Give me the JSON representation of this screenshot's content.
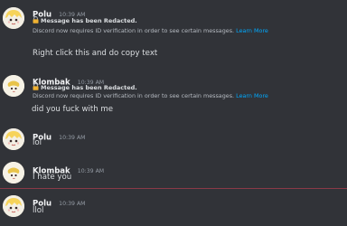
{
  "messages": [
    {
      "author": "Polu",
      "time": "10:39 AM",
      "redacted": "Message has been Redacted.",
      "notice": "Discord now requires ID verification in order to see certain messages.",
      "notice_link": "Learn More",
      "text": "Right click this and do copy text"
    },
    {
      "author": "Klombak",
      "time": "10:39 AM",
      "redacted": "Message has been Redacted.",
      "notice": "Discord now requires ID verification in order to see certain messages.",
      "notice_link": "Learn More",
      "text": "did you fuck with me"
    },
    {
      "author": "Polu",
      "time": "10:39 AM",
      "text": "lol"
    },
    {
      "author": "Klombak",
      "time": "10:39 AM",
      "text": "I hate you"
    },
    {
      "author": "Polu",
      "time": "10:39 AM",
      "text": "llol"
    }
  ],
  "colors": {
    "background": "#313338",
    "link": "#00a8fc",
    "new_divider": "#8a3a47"
  },
  "icons": [
    "lock-icon",
    "avatar-polu",
    "avatar-klombak"
  ]
}
